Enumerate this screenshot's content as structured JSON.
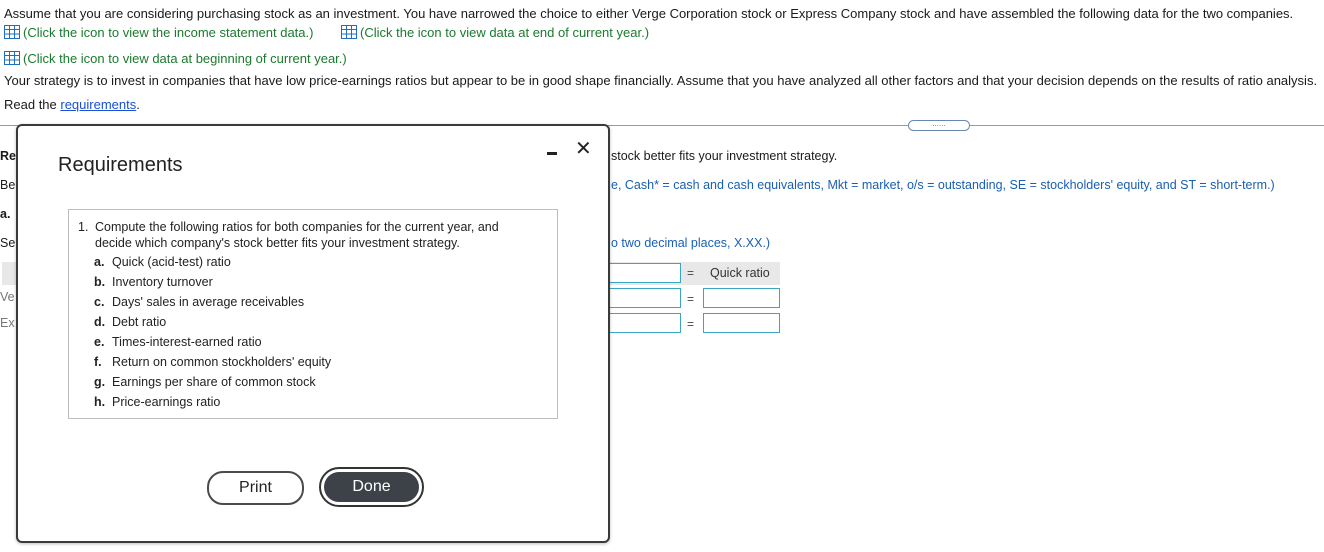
{
  "intro": {
    "line1": "Assume that you are considering purchasing stock as an investment. You have narrowed the choice to either Verge Corporation stock or Express Company stock and have assembled the following data for the two companies.",
    "link_income": "(Click the icon to view the income statement data.)",
    "link_end": "(Click the icon to view data at end of current year.)",
    "link_begin": "(Click the icon to view data at beginning of current year.)",
    "strategy": "Your strategy is to invest in companies that have low price-earnings ratios but appear to be in good shape financially. Assume that you have analyzed all other factors and that your decision depends on the results of ratio analysis.",
    "read_prefix": "Read the ",
    "read_link": "requirements",
    "read_suffix": "."
  },
  "expander_label": "......",
  "background": {
    "fragments": [
      "Re",
      "Be",
      "a.",
      "Se",
      "Ve",
      "Ex"
    ],
    "strategy_fragment": "stock better fits your investment strategy.",
    "abbrev_fragment": "e, Cash* = cash and cash equivalents, Mkt = market, o/s = outstanding, SE = stockholders' equity, and ST = short-term.)",
    "decimal_fragment": "o two decimal places, X.XX.)",
    "equals": "=",
    "quick_ratio_label": "Quick ratio"
  },
  "modal": {
    "title": "Requirements",
    "main_number": "1.",
    "main_text": "Compute the following ratios for both companies for the current year, and decide which company's stock better fits your investment strategy.",
    "items": [
      {
        "letter": "a.",
        "text": "Quick (acid-test) ratio"
      },
      {
        "letter": "b.",
        "text": "Inventory turnover"
      },
      {
        "letter": "c.",
        "text": "Days' sales in average receivables"
      },
      {
        "letter": "d.",
        "text": "Debt ratio"
      },
      {
        "letter": "e.",
        "text": "Times-interest-earned ratio"
      },
      {
        "letter": "f.",
        "text": "Return on common stockholders' equity"
      },
      {
        "letter": "g.",
        "text": "Earnings per share of common stock"
      },
      {
        "letter": "h.",
        "text": "Price-earnings ratio"
      }
    ],
    "print_label": "Print",
    "done_label": "Done"
  },
  "colors": {
    "link_green": "#1a7a2e",
    "link_blue": "#1a4fd6",
    "input_border": "#3aa6c2",
    "done_fill": "#3d4248"
  },
  "icons": {
    "table": "table-icon",
    "minimize": "minimize-icon",
    "close": "close-icon"
  }
}
